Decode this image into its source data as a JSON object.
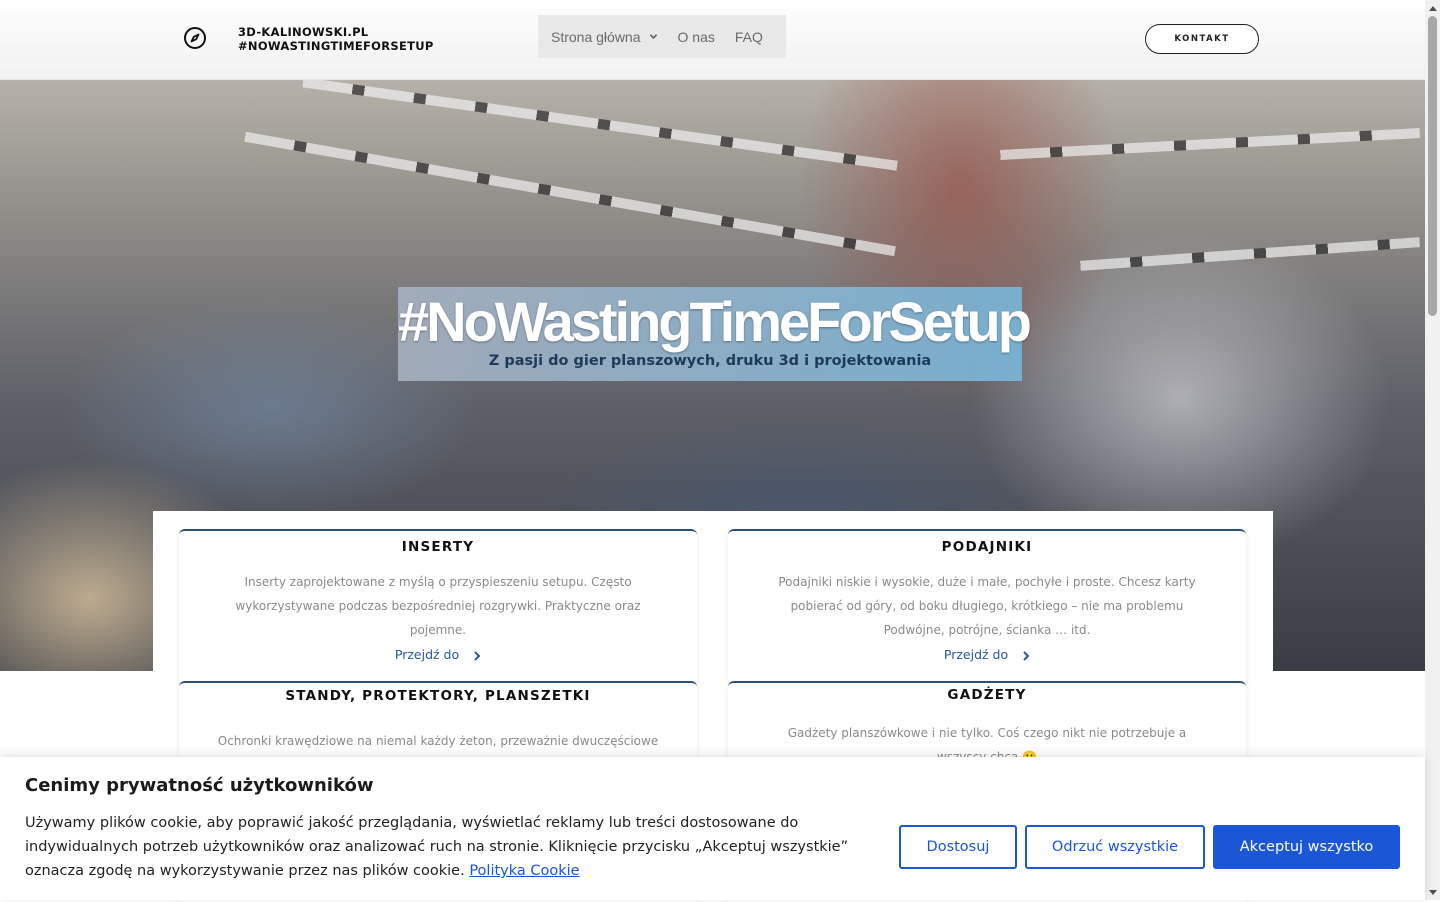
{
  "header": {
    "brand_line1": "3D-KALINOWSKI.PL",
    "brand_line2": "#NOWASTINGTIMEFORSETUP",
    "nav": [
      {
        "label": "Strona główna",
        "has_dropdown": true
      },
      {
        "label": "O nas",
        "has_dropdown": false
      },
      {
        "label": "FAQ",
        "has_dropdown": false
      }
    ],
    "contact_label": "KONTAKT"
  },
  "hero": {
    "title": "#NoWastingTimeForSetup",
    "subtitle": "Z pasji do gier planszowych, druku 3d i projektowania"
  },
  "cards": [
    {
      "title": "INSERTY",
      "text": "Inserty zaprojektowane z myślą o przyspieszeniu setupu. Często wykorzystywane podczas bezpośredniej rozgrywki. Praktyczne oraz pojemne.",
      "link": "Przejdź do"
    },
    {
      "title": "PODAJNIKI",
      "text": "Podajniki niskie i wysokie, duże i małe, pochyłe i proste. Chcesz karty pobierać od góry, od boku długiego, krótkiego – nie ma problemu  Podwójne, potrójne, ścianka … itd.",
      "link": "Przejdź do"
    },
    {
      "title": "STANDY, PROTEKTORY, PLANSZETKI",
      "text": "Ochronki krawędziowe na niemal każdy żeton, przeważnie dwuczęściowe"
    },
    {
      "title": "GADŻETY",
      "text": "Gadżety planszówkowe i  nie tylko. Coś czego nikt nie potrzebuje a wszyscy chcą 🙂"
    }
  ],
  "cookie": {
    "title": "Cenimy prywatność użytkowników",
    "text": "Używamy plików cookie, aby poprawić jakość przeglądania, wyświetlać reklamy lub treści dostosowane do indywidualnych potrzeb użytkowników oraz analizować ruch na stronie. Kliknięcie przycisku „Akceptuj wszystkie” oznacza zgodę na wykorzystywanie przez nas plików cookie.",
    "policy_link": "Polityka Cookie",
    "buttons": {
      "customize": "Dostosuj",
      "reject": "Odrzuć wszystkie",
      "accept": "Akceptuj wszystko"
    }
  },
  "colors": {
    "accent_blue": "#1a56d6",
    "card_border": "#2f4e7a",
    "hero_subtitle": "#1e3a5a"
  },
  "icons": {
    "logo": "compass-icon",
    "nav_dropdown": "chevron-down-icon",
    "card_link": "chevron-right-icon"
  }
}
